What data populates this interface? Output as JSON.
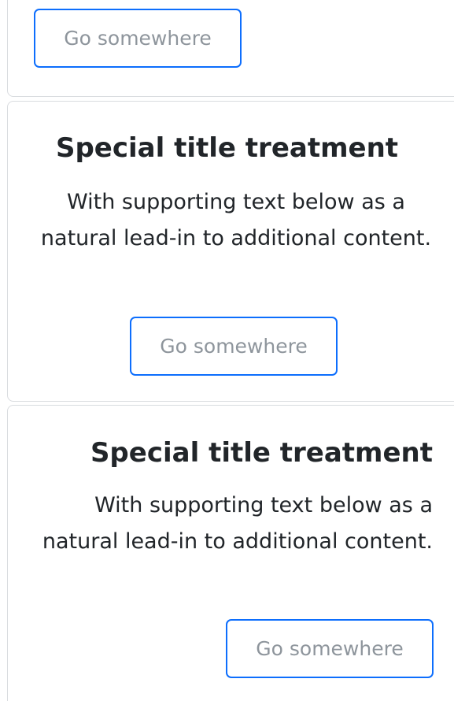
{
  "cards": [
    {
      "align": "left",
      "button_label": "Go somewhere"
    },
    {
      "align": "center",
      "title": "Special title treatment",
      "text": "With supporting text below as a natural lead-in to additional content.",
      "button_label": "Go somewhere"
    },
    {
      "align": "right",
      "title": "Special title treatment",
      "text": "With supporting text below as a natural lead-in to additional content.",
      "button_label": "Go somewhere"
    }
  ],
  "colors": {
    "primary_border": "#0d6efd",
    "button_text": "#8e959c",
    "card_border": "#d9dcdf",
    "body_text": "#212529"
  }
}
